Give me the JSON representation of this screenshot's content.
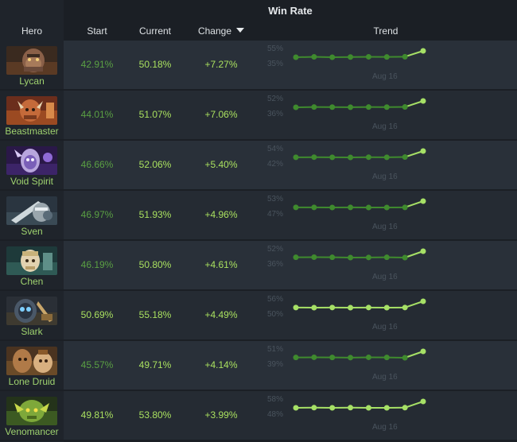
{
  "header": {
    "group_title": "Win Rate",
    "hero": "Hero",
    "start": "Start",
    "current": "Current",
    "change": "Change",
    "trend": "Trend"
  },
  "colors": {
    "line_dark": "#3f8a2e",
    "line_light": "#a6e066",
    "background": "#1b1f25"
  },
  "rows": [
    {
      "hero": "Lycan",
      "start": "42.91%",
      "current": "50.18%",
      "change": "+7.27%",
      "trend_high": "55%",
      "trend_low": "35%",
      "trend_date": "Aug 16",
      "win_rates": [
        42.91,
        43.3,
        42.9,
        43.1,
        43.4,
        43.2,
        43.5,
        50.18
      ]
    },
    {
      "hero": "Beastmaster",
      "start": "44.01%",
      "current": "51.07%",
      "change": "+7.06%",
      "trend_high": "52%",
      "trend_low": "36%",
      "trend_date": "Aug 16",
      "win_rates": [
        44.01,
        44.3,
        44.2,
        44.1,
        44.3,
        44.2,
        44.4,
        51.07
      ]
    },
    {
      "hero": "Void Spirit",
      "start": "46.66%",
      "current": "52.06%",
      "change": "+5.40%",
      "trend_high": "54%",
      "trend_low": "42%",
      "trend_date": "Aug 16",
      "win_rates": [
        46.66,
        46.8,
        46.7,
        46.6,
        46.8,
        46.7,
        46.9,
        52.06
      ]
    },
    {
      "hero": "Sven",
      "start": "46.97%",
      "current": "51.93%",
      "change": "+4.96%",
      "trend_high": "53%",
      "trend_low": "47%",
      "trend_date": "Aug 16",
      "win_rates": [
        46.97,
        47.0,
        46.9,
        47.0,
        46.9,
        46.9,
        47.0,
        51.93
      ]
    },
    {
      "hero": "Chen",
      "start": "46.19%",
      "current": "50.80%",
      "change": "+4.61%",
      "trend_high": "52%",
      "trend_low": "36%",
      "trend_date": "Aug 16",
      "win_rates": [
        46.19,
        46.3,
        46.2,
        46.0,
        46.1,
        46.2,
        46.0,
        50.8
      ]
    },
    {
      "hero": "Slark",
      "start": "50.69%",
      "current": "55.18%",
      "change": "+4.49%",
      "trend_high": "56%",
      "trend_low": "50%",
      "trend_date": "Aug 16",
      "win_rates": [
        50.69,
        50.6,
        50.7,
        50.6,
        50.7,
        50.6,
        50.7,
        55.18
      ]
    },
    {
      "hero": "Lone Druid",
      "start": "45.57%",
      "current": "49.71%",
      "change": "+4.14%",
      "trend_high": "51%",
      "trend_low": "39%",
      "trend_date": "Aug 16",
      "win_rates": [
        45.57,
        45.7,
        45.6,
        45.5,
        45.7,
        45.6,
        45.4,
        49.71
      ]
    },
    {
      "hero": "Venomancer",
      "start": "49.81%",
      "current": "53.80%",
      "change": "+3.99%",
      "trend_high": "58%",
      "trend_low": "48%",
      "trend_date": "Aug 16",
      "win_rates": [
        49.81,
        49.9,
        49.8,
        49.9,
        49.8,
        49.8,
        49.9,
        53.8
      ]
    }
  ]
}
